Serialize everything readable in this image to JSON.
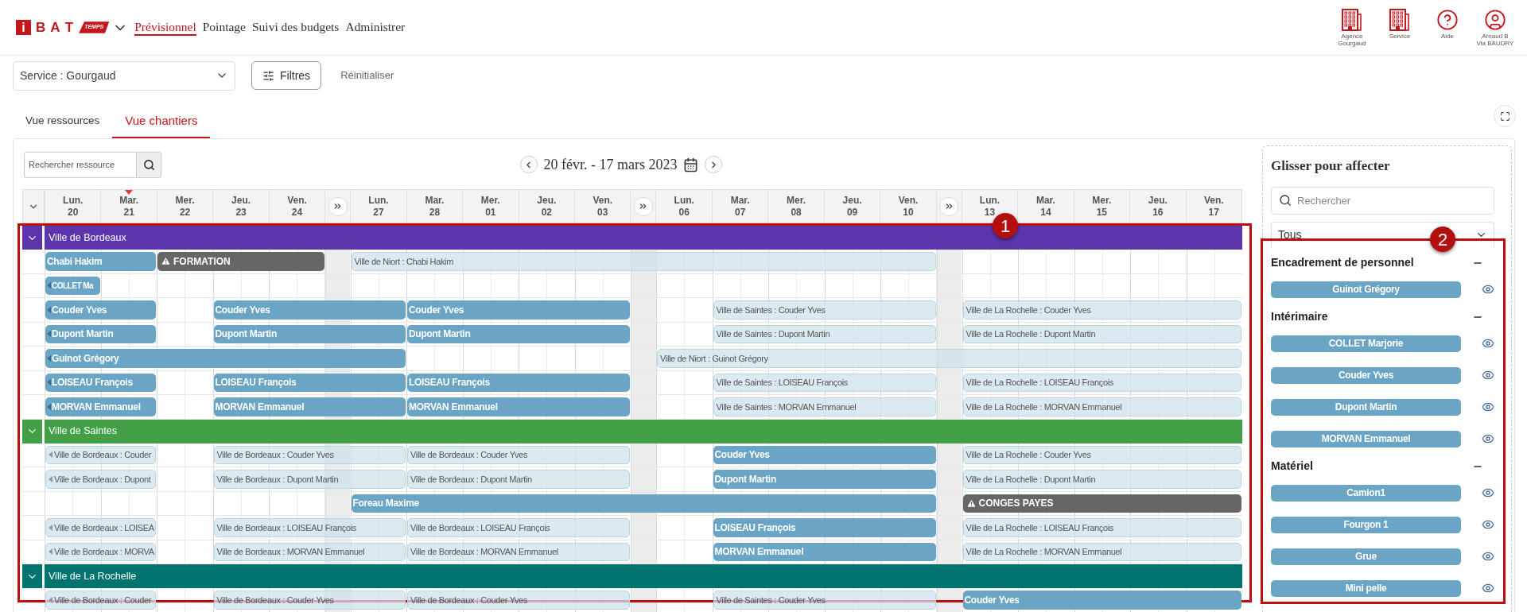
{
  "header": {
    "logo": {
      "letter": "i",
      "name": "B A T",
      "badge": "TEMPS"
    },
    "nav": [
      {
        "label": "Prévisionnel",
        "selected": true
      },
      {
        "label": "Pointage",
        "selected": false
      },
      {
        "label": "Suivi des budgets",
        "selected": false
      },
      {
        "label": "Administrer",
        "selected": false
      }
    ],
    "actions": [
      {
        "kind": "building",
        "label": "Agence Gourgaud"
      },
      {
        "kind": "building",
        "label": "Service"
      },
      {
        "kind": "help",
        "label": "Aide"
      },
      {
        "kind": "user",
        "label": "Arnaud B",
        "sublabel": "Via BAUDRY"
      }
    ]
  },
  "toolbar": {
    "service_select": "Service : Gourgaud",
    "filters_button": "Filtres",
    "reset_link": "Réinitialiser"
  },
  "view_tabs": [
    {
      "label": "Vue ressources",
      "selected": false
    },
    {
      "label": "Vue chantiers",
      "selected": true
    }
  ],
  "planning": {
    "search": {
      "placeholder": "Rechercher ressource"
    },
    "date_range": "20 févr. - 17 mars 2023",
    "weeks": [
      {
        "days": [
          {
            "weekday": "Lun.",
            "date": "20",
            "today": false
          },
          {
            "weekday": "Mar.",
            "date": "21",
            "today": true
          },
          {
            "weekday": "Mer.",
            "date": "22",
            "today": false
          },
          {
            "weekday": "Jeu.",
            "date": "23",
            "today": false
          },
          {
            "weekday": "Ven.",
            "date": "24",
            "today": false
          }
        ]
      },
      {
        "days": [
          {
            "weekday": "Lun.",
            "date": "27",
            "today": false
          },
          {
            "weekday": "Mar.",
            "date": "28",
            "today": false
          },
          {
            "weekday": "Mer.",
            "date": "01",
            "today": false
          },
          {
            "weekday": "Jeu.",
            "date": "02",
            "today": false
          },
          {
            "weekday": "Ven.",
            "date": "03",
            "today": false
          }
        ]
      },
      {
        "days": [
          {
            "weekday": "Lun.",
            "date": "06",
            "today": false
          },
          {
            "weekday": "Mar.",
            "date": "07",
            "today": false
          },
          {
            "weekday": "Mer.",
            "date": "08",
            "today": false
          },
          {
            "weekday": "Jeu.",
            "date": "09",
            "today": false
          },
          {
            "weekday": "Ven.",
            "date": "10",
            "today": false
          }
        ]
      },
      {
        "days": [
          {
            "weekday": "Lun.",
            "date": "13",
            "today": false
          },
          {
            "weekday": "Mar.",
            "date": "14",
            "today": false
          },
          {
            "weekday": "Mer.",
            "date": "15",
            "today": false
          },
          {
            "weekday": "Jeu.",
            "date": "16",
            "today": false
          },
          {
            "weekday": "Ven.",
            "date": "17",
            "today": false
          }
        ]
      }
    ],
    "groups": [
      {
        "name": "Ville de Bordeaux",
        "color": "#5c35ad",
        "expanded": true,
        "rows": [
          {
            "bars": [
              {
                "kind": "assigned",
                "label": "Chabi Hakim",
                "continued": false
              },
              {
                "kind": "absence",
                "label": "FORMATION",
                "continued": false
              },
              {
                "kind": "other_site",
                "label": "Ville de Niort : Chabi Hakim",
                "continued": false
              }
            ]
          },
          {
            "bars": [
              {
                "kind": "assigned",
                "label": "COLLET Ma",
                "continued": true
              }
            ]
          },
          {
            "bars": [
              {
                "kind": "assigned",
                "label": "Couder Yves",
                "continued": true
              },
              {
                "kind": "assigned",
                "label": "Couder Yves",
                "continued": false
              },
              {
                "kind": "assigned",
                "label": "Couder Yves",
                "continued": false
              },
              {
                "kind": "other_site",
                "label": "Ville de Saintes : Couder Yves",
                "continued": false
              },
              {
                "kind": "other_site",
                "label": "Ville de La Rochelle : Couder Yves",
                "continued": false
              }
            ]
          },
          {
            "bars": [
              {
                "kind": "assigned",
                "label": "Dupont Martin",
                "continued": true
              },
              {
                "kind": "assigned",
                "label": "Dupont Martin",
                "continued": false
              },
              {
                "kind": "assigned",
                "label": "Dupont Martin",
                "continued": false
              },
              {
                "kind": "other_site",
                "label": "Ville de Saintes : Dupont Martin",
                "continued": false
              },
              {
                "kind": "other_site",
                "label": "Ville de La Rochelle : Dupont Martin",
                "continued": false
              }
            ]
          },
          {
            "bars": [
              {
                "kind": "assigned",
                "label": "Guinot Grégory",
                "continued": true
              },
              {
                "kind": "other_site",
                "label": "Ville de Niort : Guinot Grégory",
                "continued": false
              }
            ]
          },
          {
            "bars": [
              {
                "kind": "assigned",
                "label": "LOISEAU François",
                "continued": true
              },
              {
                "kind": "assigned",
                "label": "LOISEAU François",
                "continued": false
              },
              {
                "kind": "assigned",
                "label": "LOISEAU François",
                "continued": false
              },
              {
                "kind": "other_site",
                "label": "Ville de Saintes : LOISEAU François",
                "continued": false
              },
              {
                "kind": "other_site",
                "label": "Ville de La Rochelle : LOISEAU François",
                "continued": false
              }
            ]
          },
          {
            "bars": [
              {
                "kind": "assigned",
                "label": "MORVAN Emmanuel",
                "continued": true
              },
              {
                "kind": "assigned",
                "label": "MORVAN Emmanuel",
                "continued": false
              },
              {
                "kind": "assigned",
                "label": "MORVAN Emmanuel",
                "continued": false
              },
              {
                "kind": "other_site",
                "label": "Ville de Saintes : MORVAN Emmanuel",
                "continued": false
              },
              {
                "kind": "other_site",
                "label": "Ville de La Rochelle : MORVAN Emmanuel",
                "continued": false
              }
            ]
          }
        ]
      },
      {
        "name": "Ville de Saintes",
        "color": "#43a047",
        "expanded": true,
        "rows": [
          {
            "bars": [
              {
                "kind": "other_site",
                "label": "Ville de Bordeaux : Couder",
                "continued": true
              },
              {
                "kind": "other_site",
                "label": "Ville de Bordeaux : Couder Yves",
                "continued": false
              },
              {
                "kind": "other_site",
                "label": "Ville de Bordeaux : Couder Yves",
                "continued": false
              },
              {
                "kind": "assigned",
                "label": "Couder Yves",
                "continued": false
              },
              {
                "kind": "other_site",
                "label": "Ville de La Rochelle : Couder Yves",
                "continued": false
              }
            ]
          },
          {
            "bars": [
              {
                "kind": "other_site",
                "label": "Ville de Bordeaux : Dupont",
                "continued": true
              },
              {
                "kind": "other_site",
                "label": "Ville de Bordeaux : Dupont Martin",
                "continued": false
              },
              {
                "kind": "other_site",
                "label": "Ville de Bordeaux : Dupont Martin",
                "continued": false
              },
              {
                "kind": "assigned",
                "label": "Dupont Martin",
                "continued": false
              },
              {
                "kind": "other_site",
                "label": "Ville de La Rochelle : Dupont Martin",
                "continued": false
              }
            ]
          },
          {
            "bars": [
              {
                "kind": "assigned",
                "label": "Foreau Maxime",
                "continued": false
              },
              {
                "kind": "absence",
                "label": "CONGES PAYES",
                "continued": false
              }
            ]
          },
          {
            "bars": [
              {
                "kind": "other_site",
                "label": "Ville de Bordeaux : LOISEA",
                "continued": true
              },
              {
                "kind": "other_site",
                "label": "Ville de Bordeaux : LOISEAU François",
                "continued": false
              },
              {
                "kind": "other_site",
                "label": "Ville de Bordeaux : LOISEAU François",
                "continued": false
              },
              {
                "kind": "assigned",
                "label": "LOISEAU François",
                "continued": false
              },
              {
                "kind": "other_site",
                "label": "Ville de La Rochelle : LOISEAU François",
                "continued": false
              }
            ]
          },
          {
            "bars": [
              {
                "kind": "other_site",
                "label": "Ville de Bordeaux : MORVA",
                "continued": true
              },
              {
                "kind": "other_site",
                "label": "Ville de Bordeaux : MORVAN Emmanuel",
                "continued": false
              },
              {
                "kind": "other_site",
                "label": "Ville de Bordeaux : MORVAN Emmanuel",
                "continued": false
              },
              {
                "kind": "assigned",
                "label": "MORVAN Emmanuel",
                "continued": false
              },
              {
                "kind": "other_site",
                "label": "Ville de La Rochelle : MORVAN Emmanuel",
                "continued": false
              }
            ]
          }
        ]
      },
      {
        "name": "Ville de La Rochelle",
        "color": "#00736e",
        "expanded": true,
        "rows": [
          {
            "bars": [
              {
                "kind": "other_site",
                "label": "Ville de Bordeaux : Couder",
                "continued": true
              },
              {
                "kind": "other_site",
                "label": "Ville de Bordeaux : Couder Yves",
                "continued": false
              },
              {
                "kind": "other_site",
                "label": "Ville de Bordeaux : Couder Yves",
                "continued": false
              },
              {
                "kind": "other_site",
                "label": "Ville de Saintes : Couder Yves",
                "continued": false
              },
              {
                "kind": "assigned",
                "label": "Couder Yves",
                "continued": false
              }
            ]
          }
        ]
      }
    ]
  },
  "assign_panel": {
    "title": "Glisser pour affecter",
    "search": {
      "placeholder": "Rechercher"
    },
    "filter": "Tous",
    "sections": [
      {
        "title": "Encadrement de personnel",
        "expanded": true,
        "items": [
          "Guinot Grégory"
        ]
      },
      {
        "title": "Intérimaire",
        "expanded": true,
        "items": [
          "COLLET Marjorie",
          "Couder Yves",
          "Dupont Martin",
          "MORVAN Emmanuel"
        ]
      },
      {
        "title": "Matériel",
        "expanded": true,
        "items": [
          "Camion1",
          "Fourgon 1",
          "Grue",
          "Mini pelle"
        ]
      }
    ]
  },
  "annotations": [
    {
      "label": "1"
    },
    {
      "label": "2"
    }
  ]
}
